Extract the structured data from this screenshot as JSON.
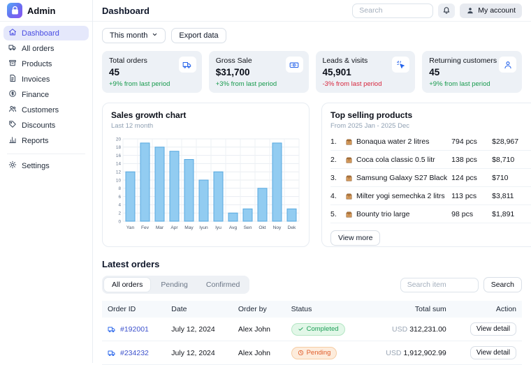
{
  "brand": {
    "name": "Admin"
  },
  "sidebar": {
    "items": [
      {
        "label": "Dashboard",
        "icon": "home",
        "active": true
      },
      {
        "label": "All orders",
        "icon": "truck",
        "active": false
      },
      {
        "label": "Products",
        "icon": "box",
        "active": false
      },
      {
        "label": "Invoices",
        "icon": "invoice",
        "active": false
      },
      {
        "label": "Finance",
        "icon": "dollar",
        "active": false
      },
      {
        "label": "Customers",
        "icon": "users",
        "active": false
      },
      {
        "label": "Discounts",
        "icon": "tag",
        "active": false
      },
      {
        "label": "Reports",
        "icon": "report",
        "active": false
      }
    ],
    "footer_items": [
      {
        "label": "Settings",
        "icon": "gear",
        "active": false
      }
    ]
  },
  "header": {
    "title": "Dashboard",
    "search_placeholder": "Search",
    "account_label": "My account"
  },
  "controls": {
    "period_label": "This month",
    "export_label": "Export data"
  },
  "stat_cards": [
    {
      "title": "Total orders",
      "value": "45",
      "delta": "+9% from last period",
      "trend": "up",
      "icon": "truck"
    },
    {
      "title": "Gross Sale",
      "value": "$31,700",
      "delta": "+3% from last period",
      "trend": "up",
      "icon": "banknote"
    },
    {
      "title": "Leads & visits",
      "value": "45,901",
      "delta": "-3% from last period",
      "trend": "down",
      "icon": "cursor-click"
    },
    {
      "title": "Returning customers",
      "value": "45",
      "delta": "+9% from last period",
      "trend": "up",
      "icon": "person"
    }
  ],
  "chart_data": {
    "type": "bar",
    "title": "Sales growth chart",
    "subtitle": "Last 12 month",
    "categories": [
      "Yan",
      "Fev",
      "Mar",
      "Apr",
      "May",
      "Iyun",
      "Iyu",
      "Avg",
      "Sen",
      "Okt",
      "Noy",
      "Dek"
    ],
    "values": [
      12,
      19,
      18,
      17,
      15,
      10,
      12,
      2,
      3,
      8,
      19,
      3
    ],
    "xlabel": "",
    "ylabel": "",
    "ylim": [
      0,
      20
    ],
    "ytick_step": 2,
    "grid": true,
    "legend": false,
    "bar_color": "#92ccf1",
    "bar_border": "#57a9e0"
  },
  "top_products": {
    "title": "Top selling products",
    "subtitle": "From 2025 Jan - 2025 Dec",
    "view_more_label": "View more",
    "items": [
      {
        "rank": "1.",
        "name": "Bonaqua water 2 litres",
        "qty": "794 pcs",
        "amount": "$28,967"
      },
      {
        "rank": "2.",
        "name": "Coca cola classic 0.5 litr",
        "qty": "138 pcs",
        "amount": "$8,710"
      },
      {
        "rank": "3.",
        "name": "Samsung Galaxy S27 Black",
        "qty": "124 pcs",
        "amount": "$710"
      },
      {
        "rank": "4.",
        "name": "Milter yogi semechka 2 litrs",
        "qty": "113 pcs",
        "amount": "$3,811"
      },
      {
        "rank": "5.",
        "name": "Bounty trio large",
        "qty": "98 pcs",
        "amount": "$1,891"
      }
    ]
  },
  "latest_orders": {
    "title": "Latest orders",
    "tabs": [
      {
        "label": "All orders",
        "active": true
      },
      {
        "label": "Pending",
        "active": false
      },
      {
        "label": "Confirmed",
        "active": false
      }
    ],
    "search_placeholder": "Search item",
    "search_button_label": "Search",
    "table": {
      "columns": [
        "Order ID",
        "Date",
        "Order by",
        "Status",
        "Total sum",
        "Action"
      ],
      "rows": [
        {
          "order_id": "#192001",
          "date": "July 12, 2024",
          "order_by": "Alex John",
          "status": "Completed",
          "status_type": "completed",
          "currency": "USD",
          "total": "312,231.00",
          "action": "View detail"
        },
        {
          "order_id": "#234232",
          "date": "July 12, 2024",
          "order_by": "Alex John",
          "status": "Pending",
          "status_type": "pending",
          "currency": "USD",
          "total": "1,912,902.99",
          "action": "View detail"
        }
      ]
    }
  },
  "colors": {
    "accent_indigo": "#474be2",
    "icon_blue": "#2563eb",
    "positive_green": "#169a4c",
    "negative_red": "#d7263d",
    "completed_text": "#1d9e57",
    "pending_text": "#e05c2a",
    "bar_fill": "#92ccf1",
    "bar_stroke": "#57a9e0"
  }
}
